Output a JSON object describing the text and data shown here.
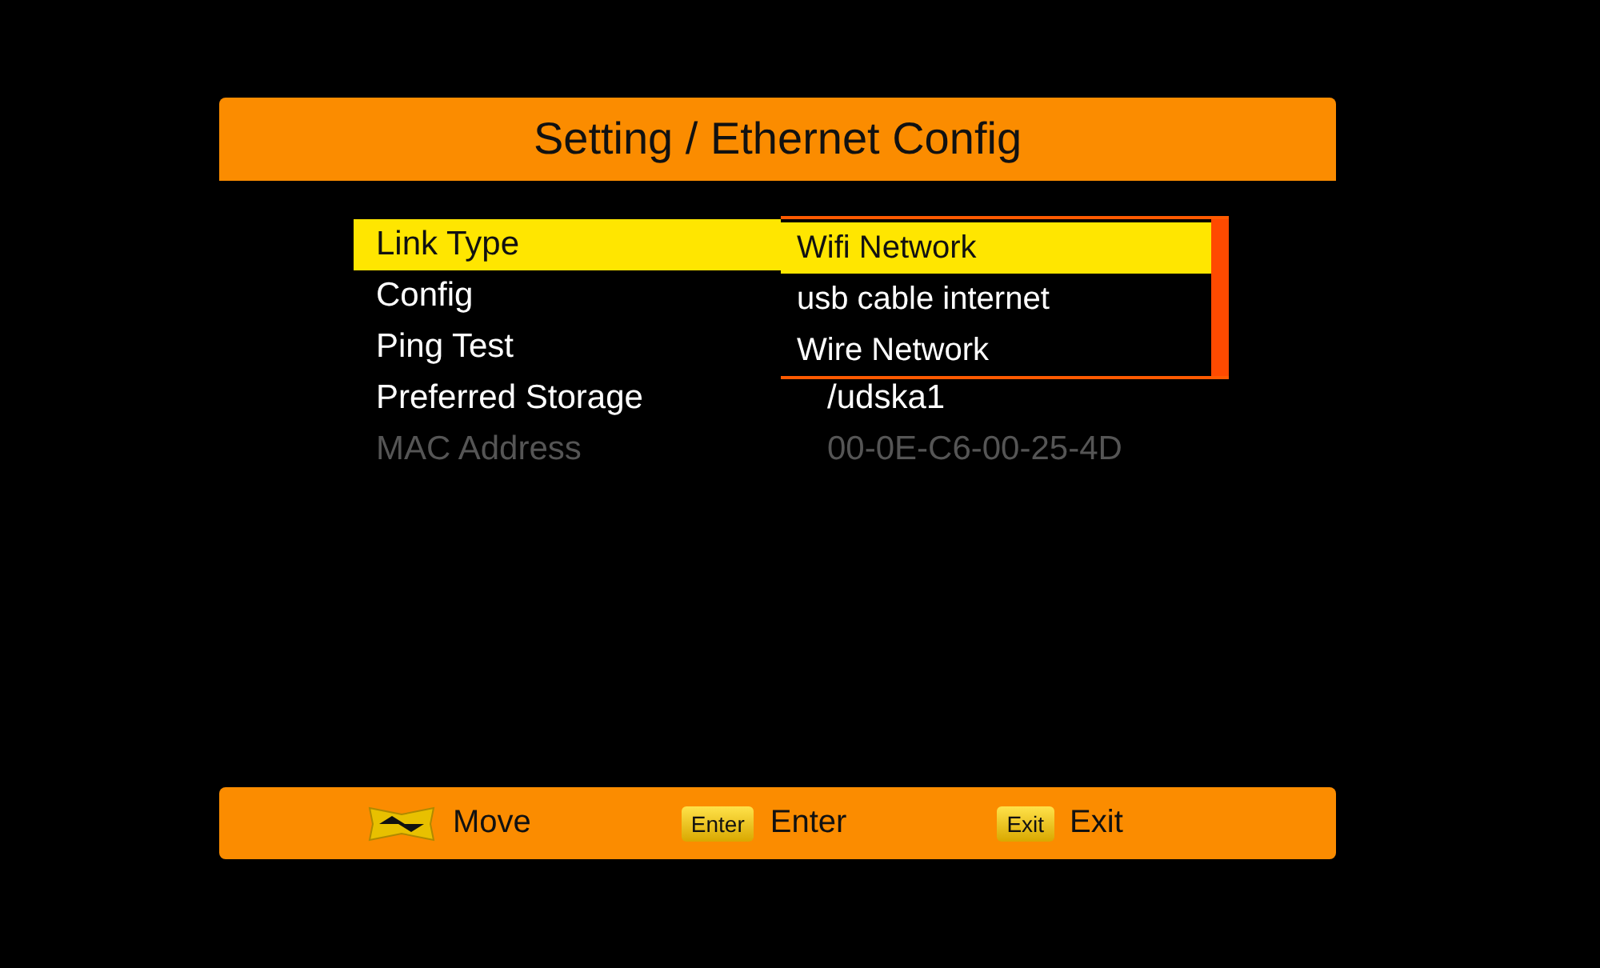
{
  "title": "Setting / Ethernet Config",
  "settings": [
    {
      "label": "Link Type",
      "selected": true,
      "disabled": false
    },
    {
      "label": "Config",
      "selected": false,
      "disabled": false
    },
    {
      "label": "Ping Test",
      "selected": false,
      "disabled": false
    },
    {
      "label": "Preferred Storage",
      "value": "/udska1",
      "selected": false,
      "disabled": false
    },
    {
      "label": "MAC Address",
      "value": "00-0E-C6-00-25-4D",
      "selected": false,
      "disabled": true
    }
  ],
  "dropdown": {
    "options": [
      {
        "label": "Wifi Network",
        "selected": true
      },
      {
        "label": "usb cable internet",
        "selected": false
      },
      {
        "label": "Wire Network",
        "selected": false
      }
    ]
  },
  "hints": [
    {
      "kind": "arrows",
      "label": "Move"
    },
    {
      "kind": "key",
      "key": "Enter",
      "label": "Enter"
    },
    {
      "kind": "key",
      "key": "Exit",
      "label": "Exit"
    }
  ]
}
